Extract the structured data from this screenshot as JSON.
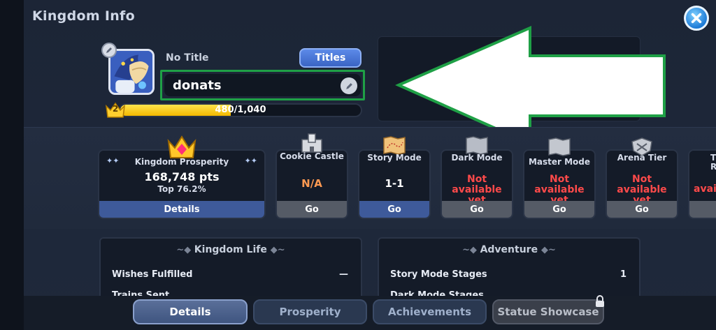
{
  "window": {
    "title": "Kingdom Info"
  },
  "profile": {
    "title_text": "No Title",
    "titles_button": "Titles",
    "name": "donats",
    "level": "2",
    "xp_text": "480/1,040",
    "xp_progress": 0.46
  },
  "cards": {
    "prosperity": {
      "label": "Kingdom Prosperity",
      "points": "168,748 pts",
      "rank": "Top 76.2%",
      "button": "Details"
    },
    "cookie_castle": {
      "label": "Cookie Castle",
      "value": "N/A",
      "button": "Go"
    },
    "story_mode": {
      "label": "Story Mode",
      "value": "1-1",
      "button": "Go"
    },
    "dark_mode": {
      "label": "Dark Mode",
      "value": "Not available yet",
      "button": "Go"
    },
    "master_mode": {
      "label": "Master Mode",
      "value": "Not available yet",
      "button": "Go"
    },
    "arena_tier": {
      "label": "Arena Tier",
      "value": "Not available yet",
      "button": "Go"
    },
    "partial": {
      "label": "T",
      "label2": "R",
      "value": "avail"
    }
  },
  "sections": {
    "kingdom_life": {
      "title": "Kingdom Life",
      "rows": [
        {
          "label": "Wishes Fulfilled",
          "value": "—"
        },
        {
          "label": "Trains Sent",
          "value": ""
        }
      ]
    },
    "adventure": {
      "title": "Adventure",
      "rows": [
        {
          "label": "Story Mode Stages",
          "value": "1"
        },
        {
          "label": "Dark Mode Stages",
          "value": ""
        }
      ]
    }
  },
  "tabs": [
    {
      "label": "Details",
      "state": "active"
    },
    {
      "label": "Prosperity",
      "state": "normal"
    },
    {
      "label": "Achievements",
      "state": "normal"
    },
    {
      "label": "Statue Showcase",
      "state": "locked"
    }
  ],
  "colors": {
    "highlight_box": "#1fa046",
    "xp_fill": "#f3b800",
    "unavailable_text": "#ff4a4a",
    "na_text": "#ff9a52"
  }
}
